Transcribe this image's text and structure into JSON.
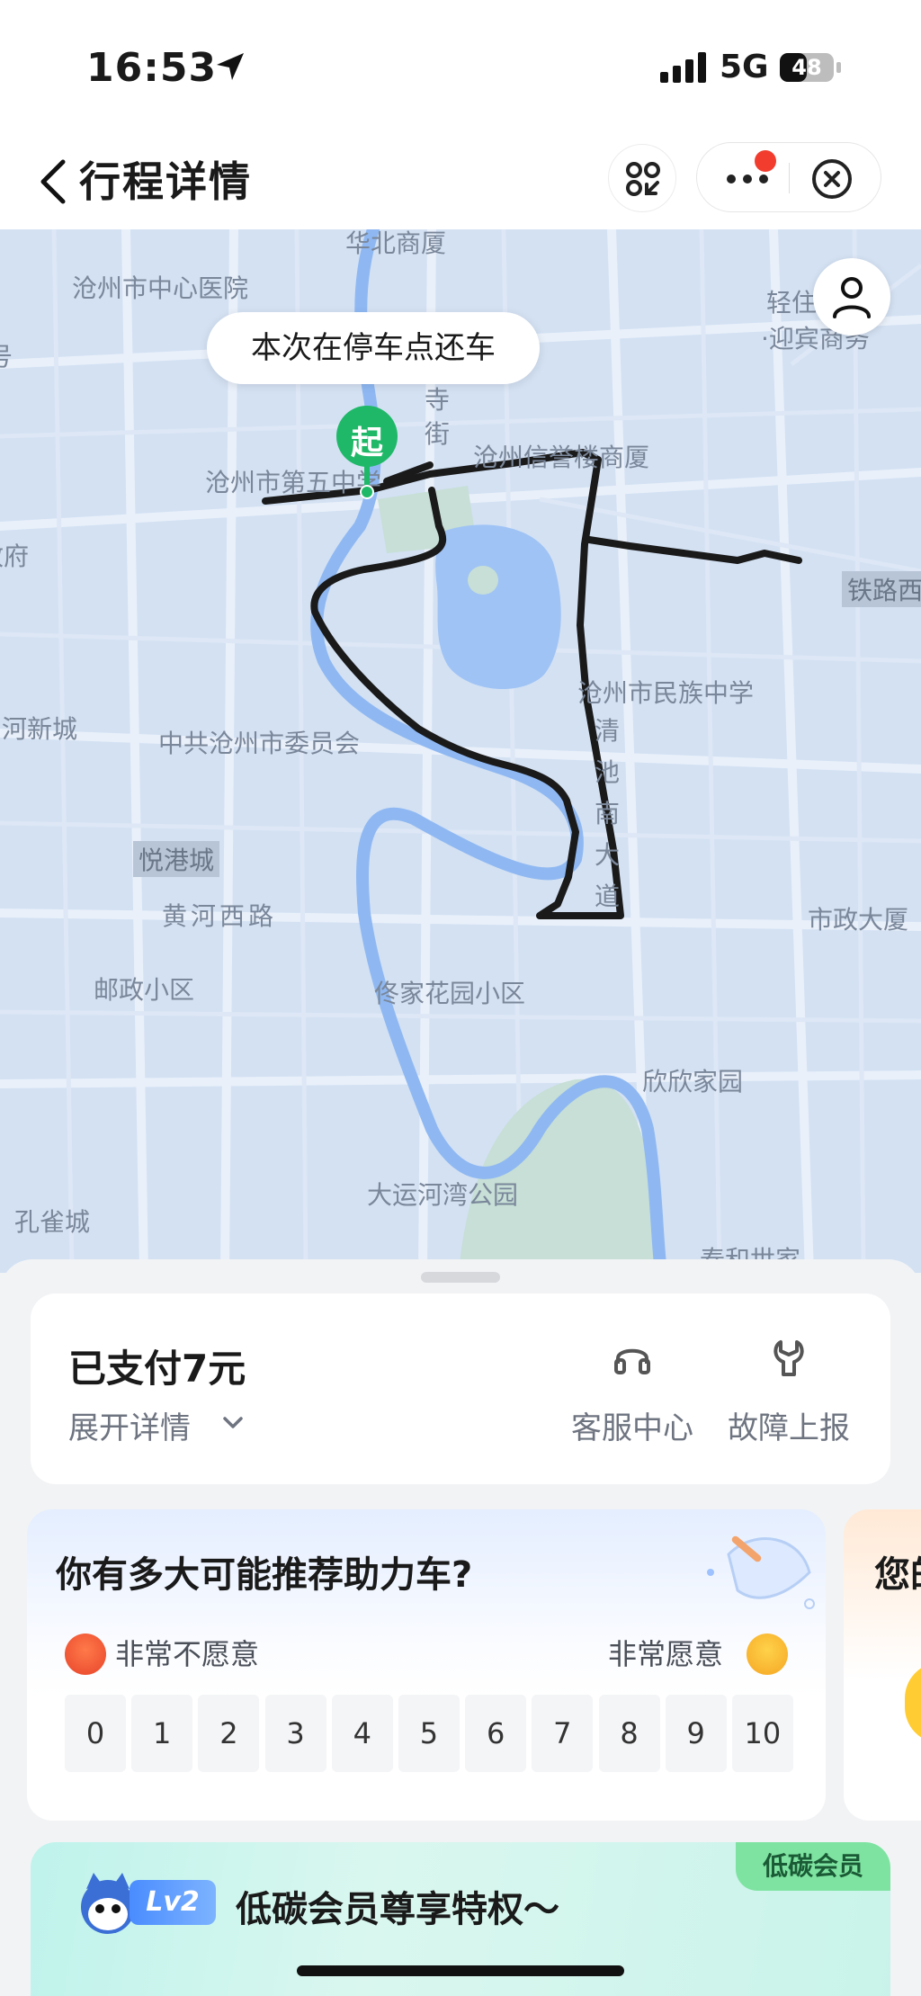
{
  "status_bar": {
    "time": "16:53",
    "network": "5G",
    "battery": "48"
  },
  "nav": {
    "title": "行程详情"
  },
  "map": {
    "tooltip": "本次在停车点还车",
    "start_pin": "起",
    "labels": {
      "huabei": "华北商厦",
      "hospital": "沧州市中心医院",
      "qingzhu": "轻住",
      "yingbin": "·迎宾商务",
      "hao": "号",
      "si": "寺",
      "jie": "街",
      "school5": "沧州市第五中学",
      "xinyu": "沧州信誉楼商厦",
      "fu": "政府",
      "railway": "铁路西",
      "hexincheng": "河新城",
      "minzu": "沧州市民族中学",
      "committee": "中共沧州市委员会",
      "yuegang": "悦港城",
      "huanghe": "黄河西路",
      "shizheng": "市政大厦",
      "youzheng": "邮政小区",
      "tongjia": "佟家花园小区",
      "xinxin": "欣欣家园",
      "park": "大运河湾公园",
      "kongque": "孔雀城",
      "taihe": "泰和世家",
      "qingchi_road": "清池南大道"
    }
  },
  "payment": {
    "title": "已支付7元",
    "expand": "展开详情",
    "service": "客服中心",
    "report": "故障上报"
  },
  "survey": {
    "question": "你有多大可能推荐助力车?",
    "low": "非常不愿意",
    "high": "非常愿意",
    "scores": [
      "0",
      "1",
      "2",
      "3",
      "4",
      "5",
      "6",
      "7",
      "8",
      "9",
      "10"
    ],
    "next_card_title": "您的"
  },
  "member": {
    "badge": "低碳会员",
    "level": "Lv2",
    "title": "低碳会员尊享特权～"
  },
  "colors": {
    "map_bg": "#d3e1f3",
    "route": "#1a1a1a",
    "start_pin": "#1fb868",
    "river": "#8fb8f2",
    "alert_dot": "#f23c2e"
  }
}
